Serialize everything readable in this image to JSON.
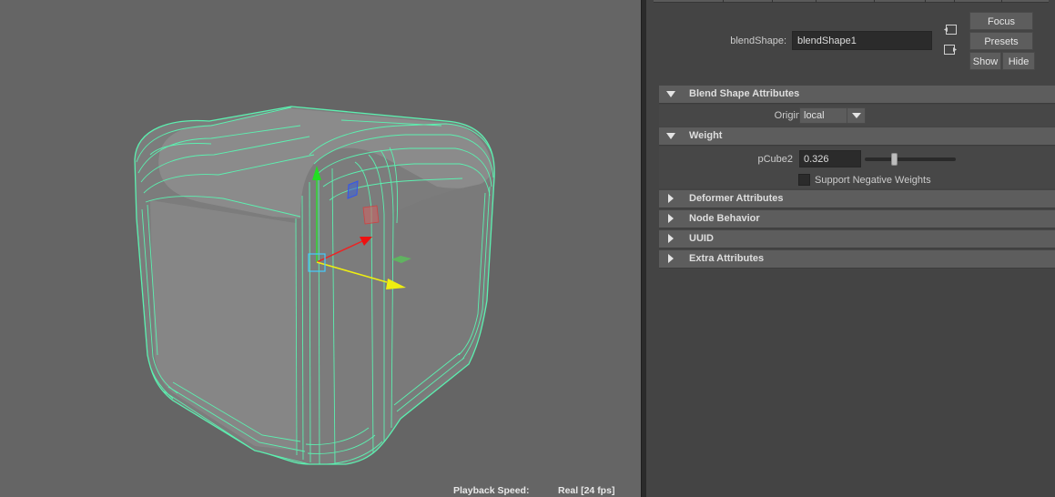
{
  "viewport": {
    "hud": {
      "playback_label": "Playback Speed:",
      "playback_value": "Real [24 fps]"
    }
  },
  "attribute_editor": {
    "node_label": "blendShape:",
    "node_name": "blendShape1",
    "buttons": {
      "focus": "Focus",
      "presets": "Presets",
      "show": "Show",
      "hide": "Hide"
    },
    "sections": {
      "blend_shape_attributes": {
        "title": "Blend Shape Attributes",
        "origin_label": "Origin",
        "origin_value": "local"
      },
      "weight": {
        "title": "Weight",
        "target_label": "pCube2",
        "target_value": "0.326",
        "slider_fraction": 0.326,
        "support_negative_label": "Support Negative Weights",
        "support_negative_checked": false
      },
      "deformer_attributes": {
        "title": "Deformer Attributes"
      },
      "node_behavior": {
        "title": "Node Behavior"
      },
      "uuid": {
        "title": "UUID"
      },
      "extra_attributes": {
        "title": "Extra Attributes"
      }
    }
  },
  "colors": {
    "viewport_bg": "#656565",
    "wireframe": "#5cf0b0",
    "panel_bg": "#444444",
    "section_header": "#5d5d5d"
  }
}
